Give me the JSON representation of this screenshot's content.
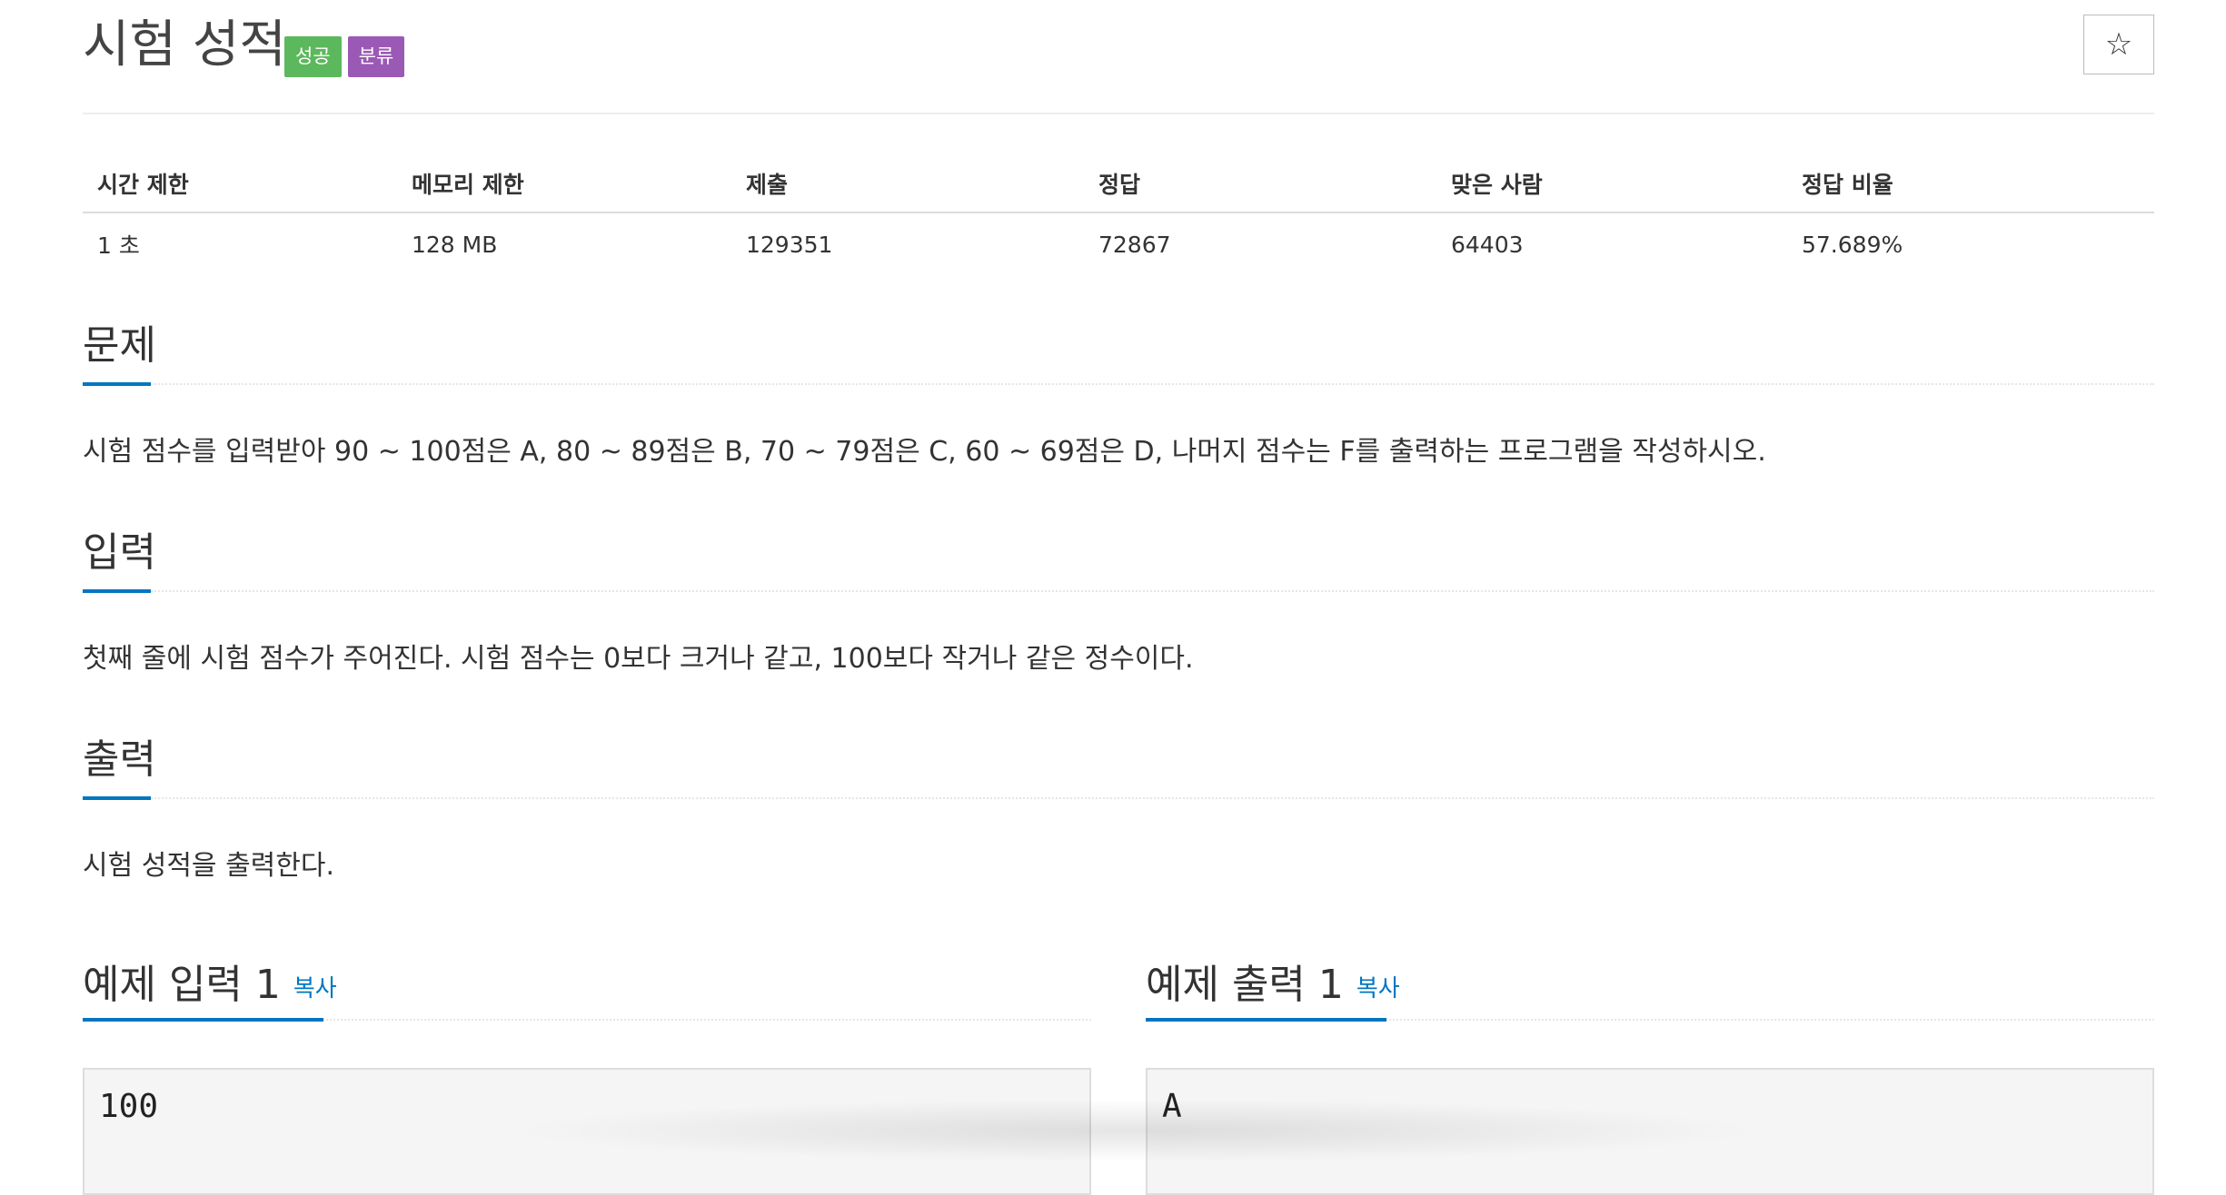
{
  "problem": {
    "title": "시험 성적",
    "badges": {
      "success": "성공",
      "category": "분류"
    },
    "star_icon": "☆"
  },
  "stats": {
    "headers": [
      "시간 제한",
      "메모리 제한",
      "제출",
      "정답",
      "맞은 사람",
      "정답 비율"
    ],
    "values": [
      "1 초",
      "128 MB",
      "129351",
      "72867",
      "64403",
      "57.689%"
    ]
  },
  "sections": {
    "description": {
      "heading": "문제",
      "text": "시험 점수를 입력받아 90 ~ 100점은 A, 80 ~ 89점은 B, 70 ~ 79점은 C, 60 ~ 69점은 D, 나머지 점수는 F를 출력하는 프로그램을 작성하시오."
    },
    "input": {
      "heading": "입력",
      "text": "첫째 줄에 시험 점수가 주어진다. 시험 점수는 0보다 크거나 같고, 100보다 작거나 같은 정수이다."
    },
    "output": {
      "heading": "출력",
      "text": "시험 성적을 출력한다."
    }
  },
  "samples": {
    "input": {
      "heading": "예제 입력 1",
      "copy_label": "복사",
      "content": "100"
    },
    "output": {
      "heading": "예제 출력 1",
      "copy_label": "복사",
      "content": "A"
    }
  },
  "colors": {
    "badge_success": "#5cb85c",
    "badge_category": "#9b59b6",
    "accent": "#0076c0"
  }
}
